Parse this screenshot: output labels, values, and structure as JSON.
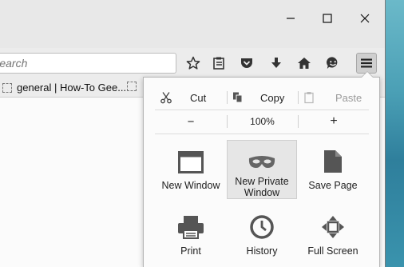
{
  "browser": {
    "url_placeholder": "Search",
    "bookmarks": [
      {
        "label": "general | How-To Gee..."
      },
      {
        "label": ""
      }
    ]
  },
  "window_controls": {
    "minimize": "minimize",
    "maximize": "maximize",
    "close": "close"
  },
  "menu": {
    "edit": {
      "cut": "Cut",
      "copy": "Copy",
      "paste": "Paste"
    },
    "zoom": {
      "minus": "−",
      "level": "100%",
      "plus": "+"
    },
    "items": [
      {
        "label": "New Window",
        "icon": "window-icon"
      },
      {
        "label": "New Private\nWindow",
        "icon": "mask-icon",
        "selected": true
      },
      {
        "label": "Save Page",
        "icon": "page-icon"
      },
      {
        "label": "Print",
        "icon": "printer-icon"
      },
      {
        "label": "History",
        "icon": "clock-icon"
      },
      {
        "label": "Full Screen",
        "icon": "fullscreen-icon"
      }
    ]
  }
}
